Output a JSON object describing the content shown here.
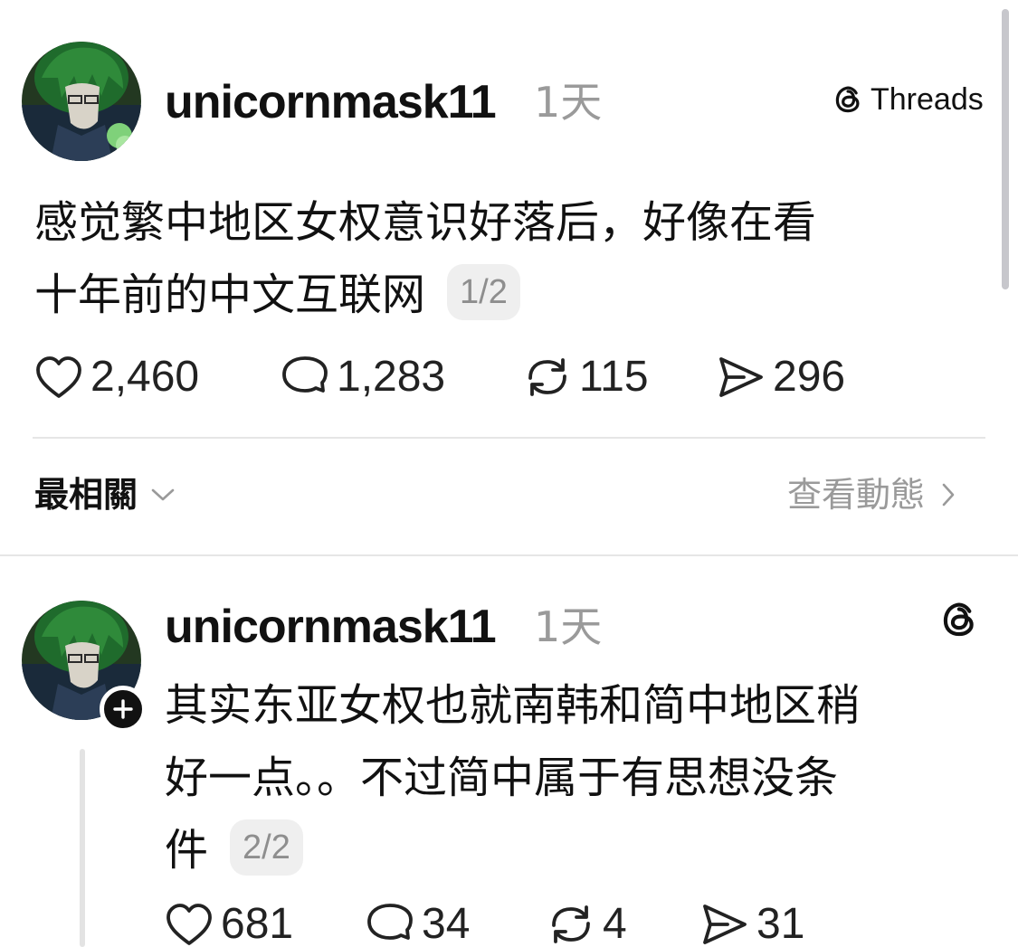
{
  "post1": {
    "username": "unicornmask11",
    "time": "1天",
    "brand": "Threads",
    "text_lines": [
      "感觉繁中地区女权意识好落后，好像在看",
      "十年前的中文互联网"
    ],
    "page_indicator": "1/2",
    "stats": {
      "likes": "2,460",
      "comments": "1,283",
      "reposts": "115",
      "shares": "296"
    }
  },
  "sort_bar": {
    "sort_label": "最相關",
    "activity_link": "查看動態"
  },
  "post2": {
    "username": "unicornmask11",
    "time": "1天",
    "text_lines": [
      "其实东亚女权也就南韩和简中地区稍",
      "好一点。。不过简中属于有思想没条",
      "件"
    ],
    "page_indicator": "2/2",
    "stats": {
      "likes": "681",
      "comments": "34",
      "reposts": "4",
      "shares": "31"
    }
  },
  "icons": {
    "avatar": "anime-avatar-image",
    "threads_logo": "threads-logo-icon",
    "like": "heart-icon",
    "comment": "comment-bubble-icon",
    "repost": "repost-icon",
    "share": "send-icon",
    "follow": "plus-icon",
    "sort_chevron": "chevron-down-icon",
    "activity_chevron": "chevron-right-icon"
  },
  "colors": {
    "text": "#111111",
    "muted": "#9a9a9a",
    "divider": "#e6e6e6",
    "badge_bg": "#efefef"
  }
}
